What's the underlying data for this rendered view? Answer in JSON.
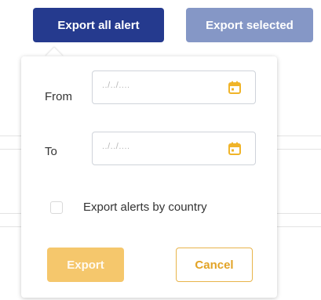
{
  "toolbar": {
    "export_all_label": "Export all alert",
    "export_selected_label": "Export selected"
  },
  "export_popover": {
    "from_label": "From",
    "to_label": "To",
    "from_placeholder": "../../....",
    "to_placeholder": "../../....",
    "from_value": "",
    "to_value": "",
    "calendar_icon": "calendar-icon",
    "by_country_label": "Export alerts by country",
    "by_country_checked": false,
    "export_label": "Export",
    "cancel_label": "Cancel"
  },
  "colors": {
    "primary": "#253a8e",
    "primary_disabled": "#8597c6",
    "accent": "#f5c76c",
    "accent_border": "#e8b44a",
    "calendar_icon": "#f0b429"
  }
}
